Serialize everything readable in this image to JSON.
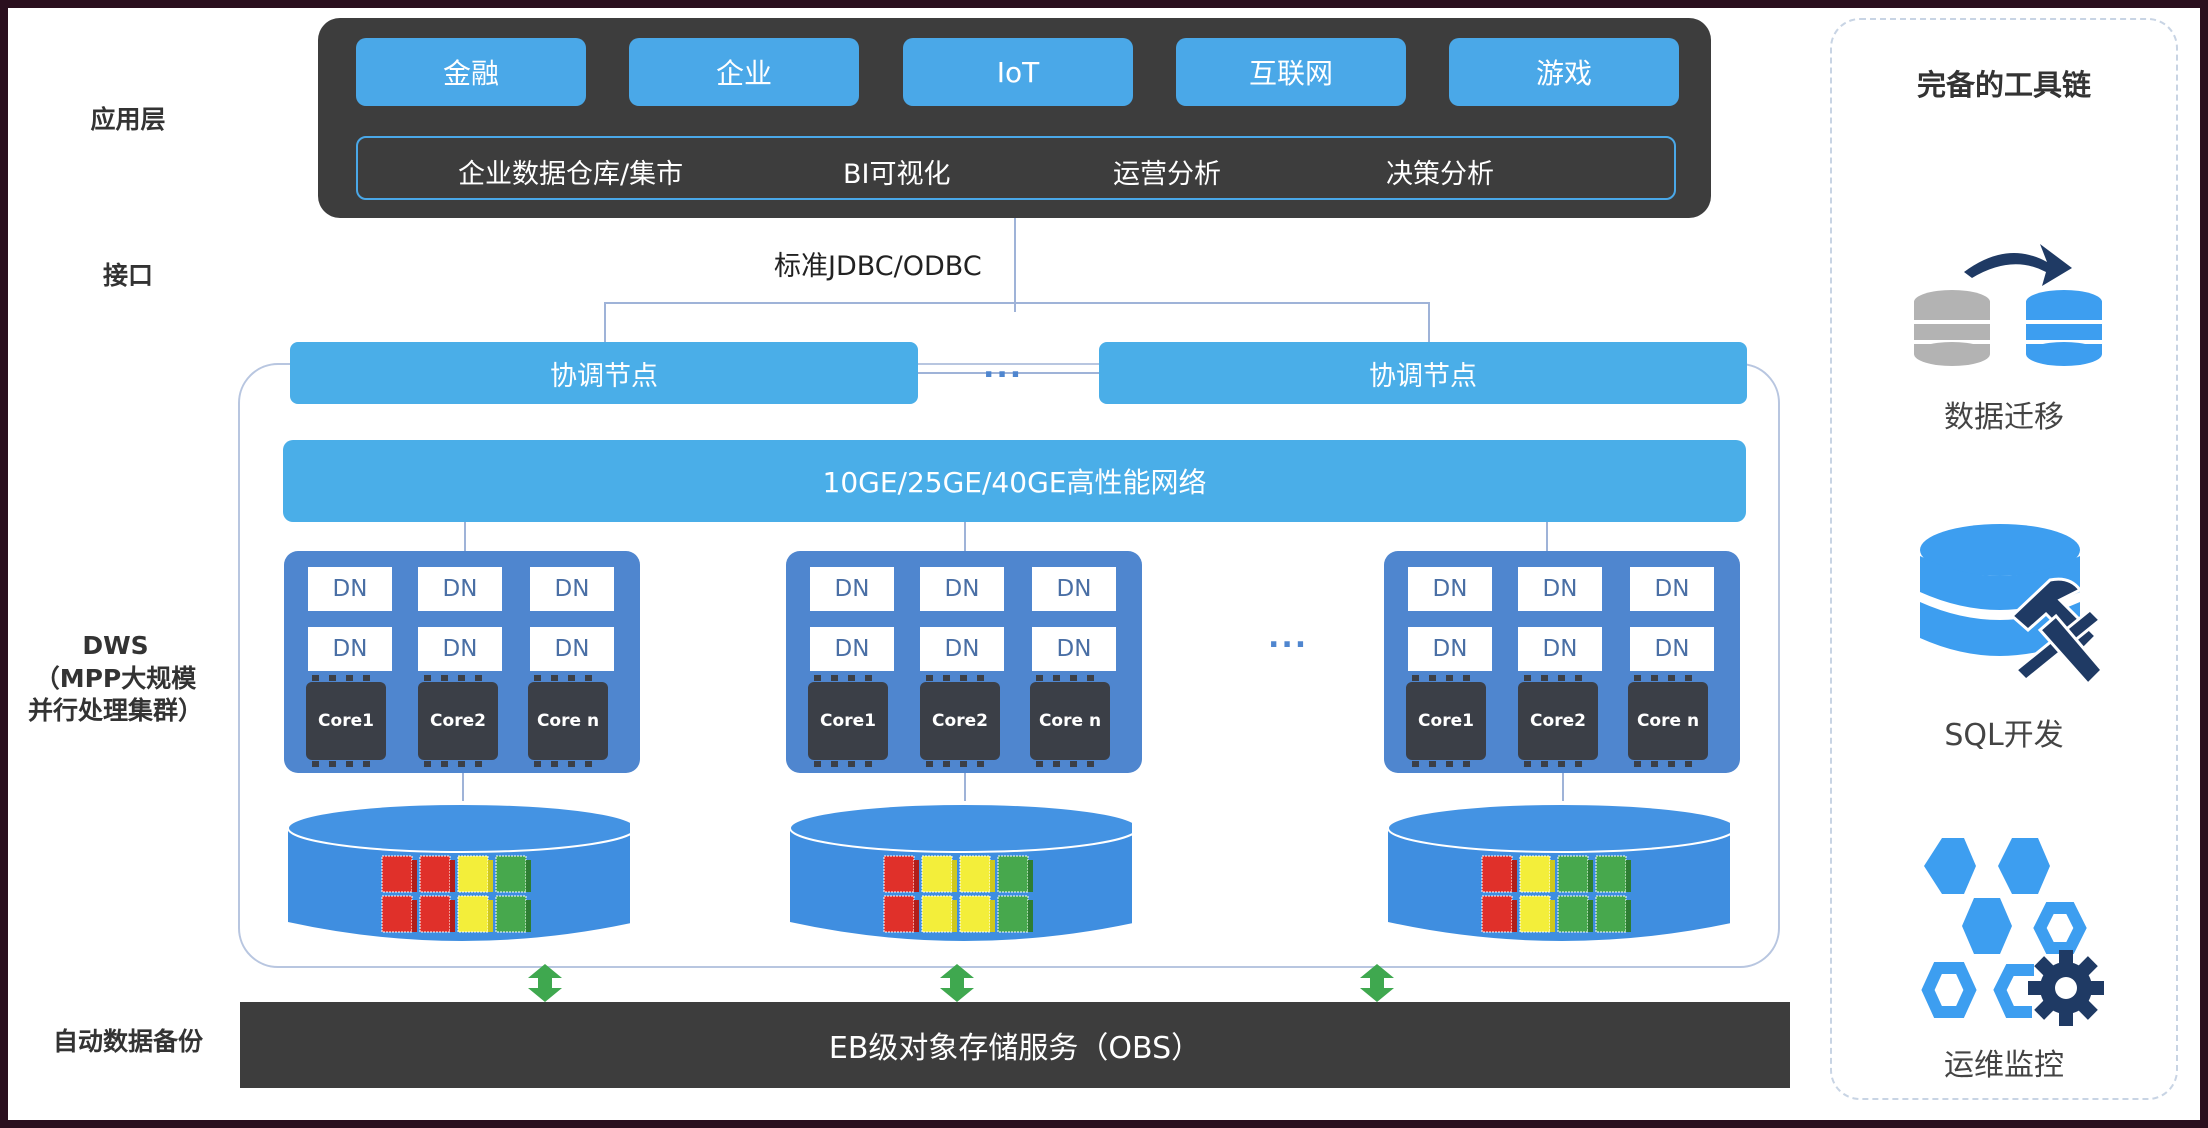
{
  "layers": {
    "application": "应用层",
    "interface": "接口",
    "dws_line1": "DWS",
    "dws_line2": "（MPP大规模",
    "dws_line3": "并行处理集群）",
    "backup": "自动数据备份"
  },
  "application_layer": {
    "industries": [
      "金融",
      "企业",
      "IoT",
      "互联网",
      "游戏"
    ],
    "scenarios": [
      "企业数据仓库/集市",
      "BI可视化",
      "运营分析",
      "决策分析"
    ]
  },
  "interface_label": "标准JDBC/ODBC",
  "coordinator_nodes": [
    "协调节点",
    "协调节点"
  ],
  "ellipsis": "...",
  "network_label": "10GE/25GE/40GE高性能网络",
  "data_nodes": [
    {
      "dn_labels": [
        "DN",
        "DN",
        "DN",
        "DN",
        "DN",
        "DN"
      ],
      "cores": [
        "Core1",
        "Core2",
        "Core n"
      ],
      "storage_blocks": [
        "red",
        "red",
        "yellow",
        "green"
      ]
    },
    {
      "dn_labels": [
        "DN",
        "DN",
        "DN",
        "DN",
        "DN",
        "DN"
      ],
      "cores": [
        "Core1",
        "Core2",
        "Core n"
      ],
      "storage_blocks": [
        "red",
        "yellow",
        "yellow",
        "green"
      ]
    },
    {
      "dn_labels": [
        "DN",
        "DN",
        "DN",
        "DN",
        "DN",
        "DN"
      ],
      "cores": [
        "Core1",
        "Core2",
        "Core n"
      ],
      "storage_blocks": [
        "red",
        "yellow",
        "green",
        "green"
      ]
    }
  ],
  "obs_label": "EB级对象存储服务（OBS）",
  "toolchain": {
    "title": "完备的工具链",
    "items": [
      {
        "label": "数据迁移",
        "icon": "data-migration-icon"
      },
      {
        "label": "SQL开发",
        "icon": "sql-development-icon"
      },
      {
        "label": "运维监控",
        "icon": "ops-monitoring-icon"
      }
    ]
  },
  "colors": {
    "accent_blue": "#4aa8e8",
    "node_blue": "#4f86cf",
    "dark_panel": "#3d3d3d",
    "tool_navy": "#1f3a64",
    "block_red": "#e0302a",
    "block_yellow": "#f3ee3a",
    "block_green": "#47a84d",
    "arrow_green": "#3fa84f"
  }
}
